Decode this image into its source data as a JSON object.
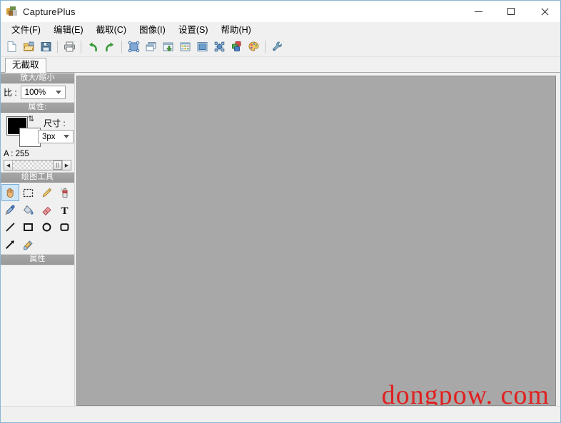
{
  "window": {
    "title": "CapturePlus",
    "app_icon": "app-logo-icon",
    "controls": {
      "minimize": "minimize-icon",
      "maximize": "maximize-icon",
      "close": "close-icon"
    }
  },
  "menubar": {
    "items": [
      {
        "label": "文件(F)",
        "name": "menu-file"
      },
      {
        "label": "编辑(E)",
        "name": "menu-edit"
      },
      {
        "label": "截取(C)",
        "name": "menu-capture"
      },
      {
        "label": "图像(I)",
        "name": "menu-image"
      },
      {
        "label": "设置(S)",
        "name": "menu-settings"
      },
      {
        "label": "帮助(H)",
        "name": "menu-help"
      }
    ]
  },
  "toolbar": {
    "items": [
      {
        "icon": "new-file-icon"
      },
      {
        "icon": "open-folder-icon"
      },
      {
        "icon": "save-icon"
      },
      {
        "icon": "separator"
      },
      {
        "icon": "print-icon"
      },
      {
        "icon": "separator"
      },
      {
        "icon": "undo-icon"
      },
      {
        "icon": "redo-icon"
      },
      {
        "icon": "separator"
      },
      {
        "icon": "capture-region-icon"
      },
      {
        "icon": "capture-window-icon"
      },
      {
        "icon": "capture-scrolling-icon"
      },
      {
        "icon": "capture-menu-icon"
      },
      {
        "icon": "capture-fullscreen-icon"
      },
      {
        "icon": "capture-object-icon"
      },
      {
        "icon": "color-blocks-icon"
      },
      {
        "icon": "palette-icon"
      },
      {
        "icon": "separator"
      },
      {
        "icon": "wrench-icon"
      }
    ]
  },
  "tabs": [
    {
      "label": "无截取",
      "name": "tab-no-capture",
      "active": true
    }
  ],
  "sidebar": {
    "zoom_section": {
      "header": "放大/缩小",
      "ratio_label": "比 :",
      "ratio_value": "100%"
    },
    "attributes_section": {
      "header": "属性:",
      "size_label": "尺寸 :",
      "size_value": "3px",
      "foreground_color": "#000000",
      "background_color": "#ffffff",
      "swap_icon": "swap-colors-icon",
      "alpha_text": "A : 255",
      "alpha_value": 255,
      "alpha_max": 255
    },
    "tools_section": {
      "header": "绘图工具",
      "tools": [
        {
          "name": "tool-hand",
          "icon": "hand-icon",
          "active": true
        },
        {
          "name": "tool-select",
          "icon": "marquee-select-icon",
          "active": false
        },
        {
          "name": "tool-pencil",
          "icon": "pencil-icon",
          "active": false
        },
        {
          "name": "tool-spray",
          "icon": "spray-can-icon",
          "active": false
        },
        {
          "name": "tool-eyedropper",
          "icon": "eyedropper-icon",
          "active": false
        },
        {
          "name": "tool-fill",
          "icon": "paint-bucket-icon",
          "active": false
        },
        {
          "name": "tool-eraser",
          "icon": "eraser-icon",
          "active": false
        },
        {
          "name": "tool-text",
          "icon": "text-icon",
          "active": false
        },
        {
          "name": "tool-line",
          "icon": "line-icon",
          "active": false
        },
        {
          "name": "tool-rectangle",
          "icon": "rectangle-icon",
          "active": false
        },
        {
          "name": "tool-ellipse",
          "icon": "ellipse-icon",
          "active": false
        },
        {
          "name": "tool-rounded-rect",
          "icon": "rounded-rectangle-icon",
          "active": false
        },
        {
          "name": "tool-arrow",
          "icon": "arrow-icon",
          "active": false
        },
        {
          "name": "tool-highlighter",
          "icon": "highlighter-icon",
          "active": false
        }
      ]
    },
    "properties_section": {
      "header": "属性"
    }
  },
  "canvas": {
    "background_color": "#a8a8a8",
    "watermark": "dongpow. com",
    "watermark_color": "#e02020"
  }
}
